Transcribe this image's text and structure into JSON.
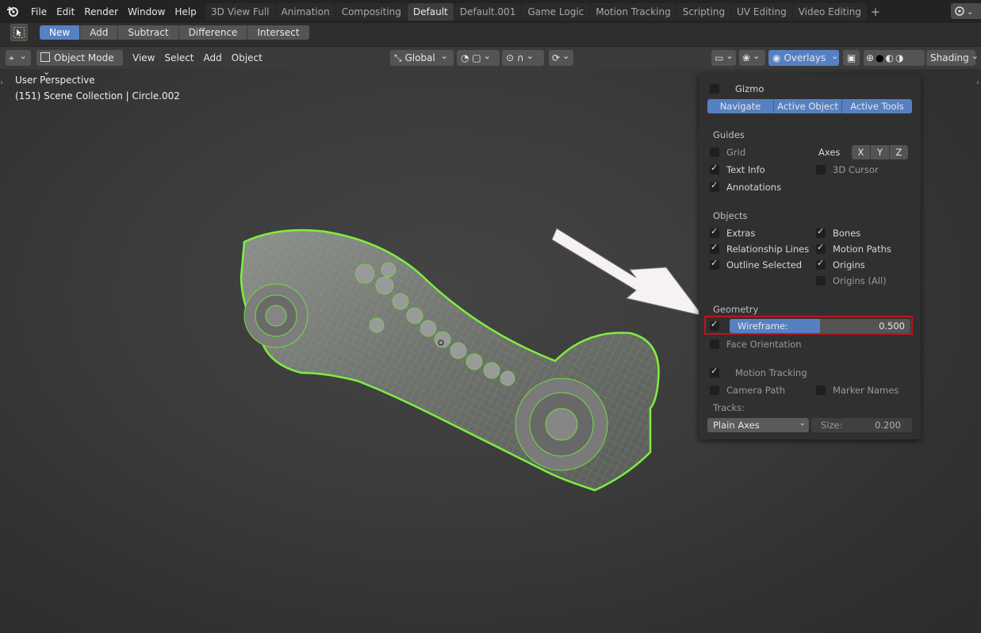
{
  "menu": [
    "File",
    "Edit",
    "Render",
    "Window",
    "Help"
  ],
  "workspaces": [
    "3D View Full",
    "Animation",
    "Compositing",
    "Default",
    "Default.001",
    "Game Logic",
    "Motion Tracking",
    "Scripting",
    "UV Editing",
    "Video Editing"
  ],
  "active_workspace": "Default",
  "boolean_ops": [
    "New",
    "Add",
    "Subtract",
    "Difference",
    "Intersect"
  ],
  "active_boolean": "New",
  "header": {
    "mode": "Object Mode",
    "menus": [
      "View",
      "Select",
      "Add",
      "Object"
    ],
    "orientation": "Global",
    "overlays_label": "Overlays",
    "shading_label": "Shading"
  },
  "viewport": {
    "view_name": "User Perspective",
    "collection_info": "(151) Scene Collection | Circle.002"
  },
  "overlay_panel": {
    "gizmo": {
      "label": "Gizmo",
      "checked": false,
      "tabs": [
        "Navigate",
        "Active Object",
        "Active Tools"
      ]
    },
    "guides": {
      "title": "Guides",
      "grid": {
        "label": "Grid",
        "checked": false
      },
      "axes_label": "Axes",
      "axes": [
        "X",
        "Y",
        "Z"
      ],
      "text_info": {
        "label": "Text Info",
        "checked": true
      },
      "cursor_3d": {
        "label": "3D Cursor",
        "checked": false
      },
      "annotations": {
        "label": "Annotations",
        "checked": true
      }
    },
    "objects": {
      "title": "Objects",
      "extras": {
        "label": "Extras",
        "checked": true
      },
      "bones": {
        "label": "Bones",
        "checked": true
      },
      "relationship_lines": {
        "label": "Relationship Lines",
        "checked": true
      },
      "motion_paths": {
        "label": "Motion Paths",
        "checked": true
      },
      "outline_selected": {
        "label": "Outline Selected",
        "checked": true
      },
      "origins": {
        "label": "Origins",
        "checked": true
      },
      "origins_all": {
        "label": "Origins (All)",
        "checked": false
      }
    },
    "geometry": {
      "title": "Geometry",
      "wireframe": {
        "label": "Wireframe:",
        "value": "0.500",
        "fraction": 0.5,
        "checked": true
      },
      "face_orientation": {
        "label": "Face Orientation",
        "checked": false
      }
    },
    "motion_tracking": {
      "label": "Motion Tracking",
      "checked": true,
      "camera_path": {
        "label": "Camera Path",
        "checked": false
      },
      "marker_names": {
        "label": "Marker Names",
        "checked": false
      },
      "tracks_label": "Tracks:",
      "tracks_value": "Plain Axes",
      "size_label": "Size:",
      "size_value": "0.200"
    }
  },
  "colors": {
    "accent": "#5680c2",
    "highlight_box": "#c0141a",
    "wire": "#6fe03a"
  }
}
